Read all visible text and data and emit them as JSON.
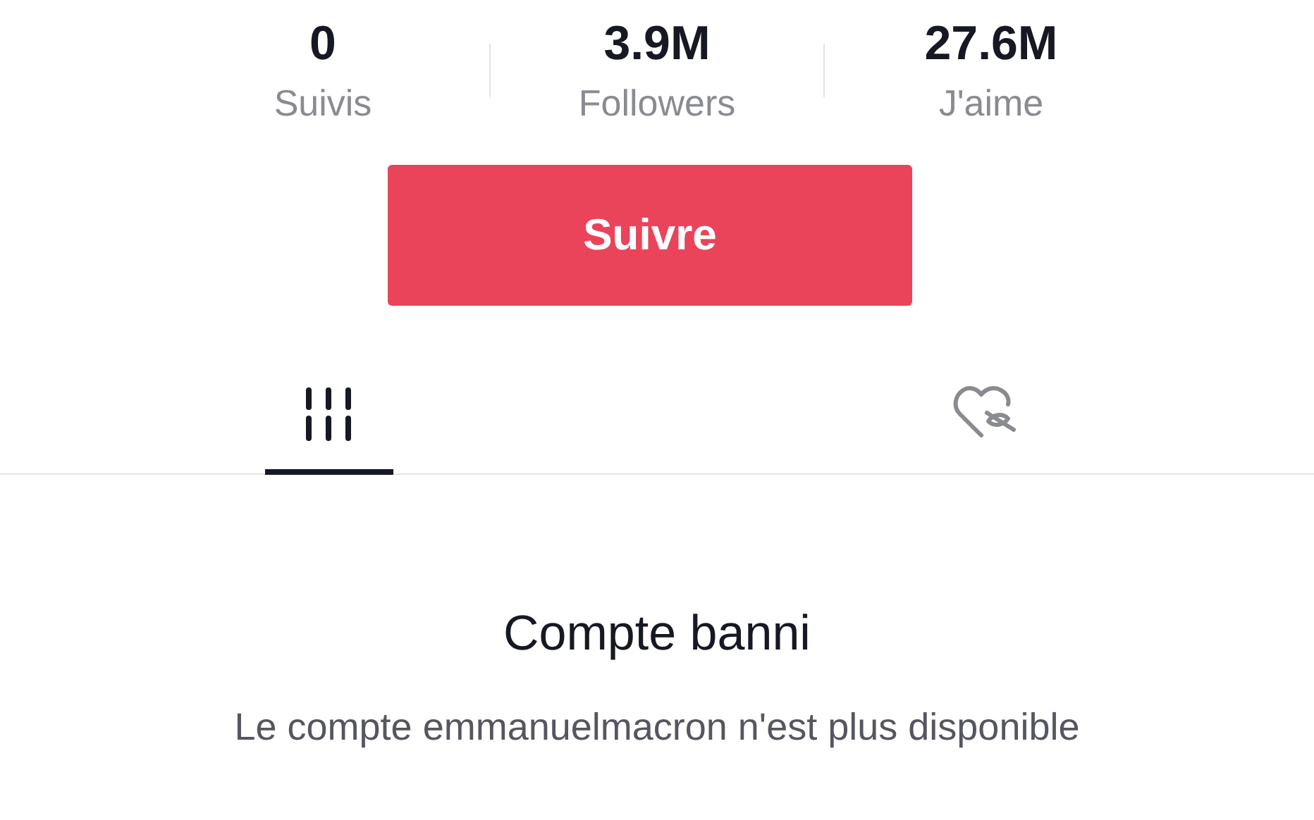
{
  "stats": [
    {
      "value": "0",
      "label": "Suivis"
    },
    {
      "value": "3.9M",
      "label": "Followers"
    },
    {
      "value": "27.6M",
      "label": "J'aime"
    }
  ],
  "follow_button": {
    "label": "Suivre"
  },
  "tabs": [
    {
      "kind": "videos",
      "selected": true
    },
    {
      "kind": "liked",
      "selected": false
    }
  ],
  "empty_state": {
    "title": "Compte banni",
    "message": "Le compte emmanuelmacron n'est plus disponible"
  }
}
